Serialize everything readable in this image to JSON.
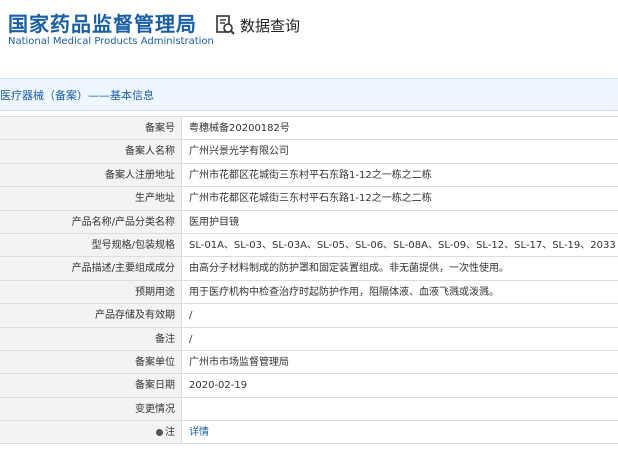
{
  "header": {
    "site_name_cn": "国家药品监督管理局",
    "site_name_en": "National Medical Products Administration",
    "query_label": "数据查询",
    "query_icon": "search-document-icon"
  },
  "section": {
    "title": "医疗器械（备案）——基本信息"
  },
  "rows": [
    {
      "label": "备案号",
      "value": "粤穗械备20200182号"
    },
    {
      "label": "备案人名称",
      "value": "广州兴景光学有限公司"
    },
    {
      "label": "备案人注册地址",
      "value": "广州市花都区花城街三东村平石东路1-12之一栋之二栋"
    },
    {
      "label": "生产地址",
      "value": "广州市花都区花城街三东村平石东路1-12之一栋之二栋"
    },
    {
      "label": "产品名称/产品分类名称",
      "value": "医用护目镜"
    },
    {
      "label": "型号规格/包装规格",
      "value": "SL-01A、SL-03、SL-03A、SL-05、SL-06、SL-08A、SL-09、SL-12、SL-17、SL-19、2033"
    },
    {
      "label": "产品描述/主要组成成分",
      "value": "由高分子材料制成的防护罩和固定装置组成。非无菌提供，一次性使用。"
    },
    {
      "label": "预期用途",
      "value": "用于医疗机构中检查治疗时起防护作用，阻隔体液、血液飞溅或泼溅。"
    },
    {
      "label": "产品存储及有效期",
      "value": "/"
    },
    {
      "label": "备注",
      "value": "/"
    },
    {
      "label": "备案单位",
      "value": "广州市市场监督管理局"
    },
    {
      "label": "备案日期",
      "value": "2020-02-19"
    },
    {
      "label": "变更情况",
      "value": ""
    },
    {
      "label": "注",
      "value": "详情",
      "icon": "pin-icon"
    }
  ],
  "colors": {
    "brand": "#1a5fa6",
    "section_bg": "#eef6ff",
    "label_bg": "#f3f3f3",
    "border": "#dcdcdc"
  }
}
